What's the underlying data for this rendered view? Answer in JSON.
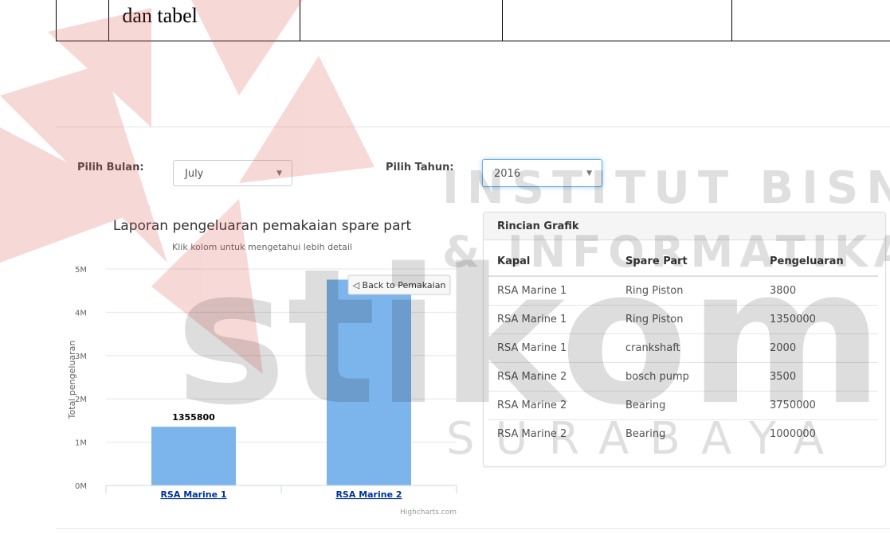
{
  "document": {
    "table_cell_text": "dan tabel"
  },
  "watermark": {
    "line1": "INSTITUT BISNIS",
    "line2": "& INFORMATIKA",
    "brand": "stikom",
    "city": "SURABAYA"
  },
  "filters": {
    "month_label": "Pilih Bulan:",
    "month_value": "July",
    "year_label": "Pilih Tahun:",
    "year_value": "2016"
  },
  "chart_data": {
    "type": "bar",
    "title": "Laporan pengeluaran pemakaian spare part",
    "subtitle": "Klik kolom untuk mengetahui lebih detail",
    "ylabel": "Total pengeluaran",
    "xlabel": "",
    "categories": [
      "RSA Marine 1",
      "RSA Marine 2"
    ],
    "values": [
      1355800,
      4753500
    ],
    "data_labels": [
      "1355800",
      ""
    ],
    "yticks": [
      "0M",
      "1M",
      "2M",
      "3M",
      "4M",
      "5M"
    ],
    "ylim": [
      0,
      5000000
    ],
    "color": "#7cb5ec",
    "back_button": "◁ Back to Pemakaian",
    "credits": "Highcharts.com"
  },
  "details": {
    "heading": "Rincian Grafik",
    "columns": [
      "Kapal",
      "Spare Part",
      "Pengeluaran"
    ],
    "rows": [
      [
        "RSA Marine 1",
        "Ring Piston",
        "3800"
      ],
      [
        "RSA Marine 1",
        "Ring Piston",
        "1350000"
      ],
      [
        "RSA Marine 1",
        "crankshaft",
        "2000"
      ],
      [
        "RSA Marine 2",
        "bosch pump",
        "3500"
      ],
      [
        "RSA Marine 2",
        "Bearing",
        "3750000"
      ],
      [
        "RSA Marine 2",
        "Bearing",
        "1000000"
      ]
    ]
  }
}
